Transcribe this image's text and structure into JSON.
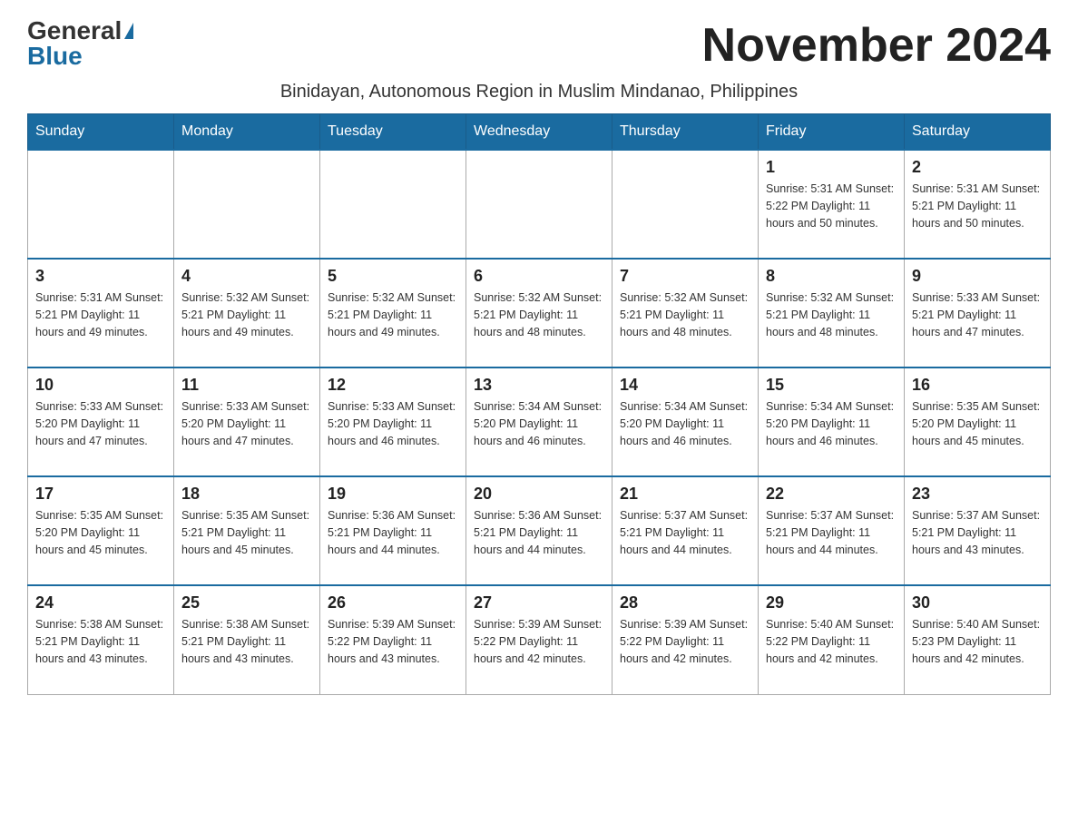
{
  "logo": {
    "general": "General",
    "blue": "Blue"
  },
  "title": "November 2024",
  "subtitle": "Binidayan, Autonomous Region in Muslim Mindanao, Philippines",
  "days_of_week": [
    "Sunday",
    "Monday",
    "Tuesday",
    "Wednesday",
    "Thursday",
    "Friday",
    "Saturday"
  ],
  "weeks": [
    [
      {
        "day": "",
        "info": ""
      },
      {
        "day": "",
        "info": ""
      },
      {
        "day": "",
        "info": ""
      },
      {
        "day": "",
        "info": ""
      },
      {
        "day": "",
        "info": ""
      },
      {
        "day": "1",
        "info": "Sunrise: 5:31 AM\nSunset: 5:22 PM\nDaylight: 11 hours and 50 minutes."
      },
      {
        "day": "2",
        "info": "Sunrise: 5:31 AM\nSunset: 5:21 PM\nDaylight: 11 hours and 50 minutes."
      }
    ],
    [
      {
        "day": "3",
        "info": "Sunrise: 5:31 AM\nSunset: 5:21 PM\nDaylight: 11 hours and 49 minutes."
      },
      {
        "day": "4",
        "info": "Sunrise: 5:32 AM\nSunset: 5:21 PM\nDaylight: 11 hours and 49 minutes."
      },
      {
        "day": "5",
        "info": "Sunrise: 5:32 AM\nSunset: 5:21 PM\nDaylight: 11 hours and 49 minutes."
      },
      {
        "day": "6",
        "info": "Sunrise: 5:32 AM\nSunset: 5:21 PM\nDaylight: 11 hours and 48 minutes."
      },
      {
        "day": "7",
        "info": "Sunrise: 5:32 AM\nSunset: 5:21 PM\nDaylight: 11 hours and 48 minutes."
      },
      {
        "day": "8",
        "info": "Sunrise: 5:32 AM\nSunset: 5:21 PM\nDaylight: 11 hours and 48 minutes."
      },
      {
        "day": "9",
        "info": "Sunrise: 5:33 AM\nSunset: 5:21 PM\nDaylight: 11 hours and 47 minutes."
      }
    ],
    [
      {
        "day": "10",
        "info": "Sunrise: 5:33 AM\nSunset: 5:20 PM\nDaylight: 11 hours and 47 minutes."
      },
      {
        "day": "11",
        "info": "Sunrise: 5:33 AM\nSunset: 5:20 PM\nDaylight: 11 hours and 47 minutes."
      },
      {
        "day": "12",
        "info": "Sunrise: 5:33 AM\nSunset: 5:20 PM\nDaylight: 11 hours and 46 minutes."
      },
      {
        "day": "13",
        "info": "Sunrise: 5:34 AM\nSunset: 5:20 PM\nDaylight: 11 hours and 46 minutes."
      },
      {
        "day": "14",
        "info": "Sunrise: 5:34 AM\nSunset: 5:20 PM\nDaylight: 11 hours and 46 minutes."
      },
      {
        "day": "15",
        "info": "Sunrise: 5:34 AM\nSunset: 5:20 PM\nDaylight: 11 hours and 46 minutes."
      },
      {
        "day": "16",
        "info": "Sunrise: 5:35 AM\nSunset: 5:20 PM\nDaylight: 11 hours and 45 minutes."
      }
    ],
    [
      {
        "day": "17",
        "info": "Sunrise: 5:35 AM\nSunset: 5:20 PM\nDaylight: 11 hours and 45 minutes."
      },
      {
        "day": "18",
        "info": "Sunrise: 5:35 AM\nSunset: 5:21 PM\nDaylight: 11 hours and 45 minutes."
      },
      {
        "day": "19",
        "info": "Sunrise: 5:36 AM\nSunset: 5:21 PM\nDaylight: 11 hours and 44 minutes."
      },
      {
        "day": "20",
        "info": "Sunrise: 5:36 AM\nSunset: 5:21 PM\nDaylight: 11 hours and 44 minutes."
      },
      {
        "day": "21",
        "info": "Sunrise: 5:37 AM\nSunset: 5:21 PM\nDaylight: 11 hours and 44 minutes."
      },
      {
        "day": "22",
        "info": "Sunrise: 5:37 AM\nSunset: 5:21 PM\nDaylight: 11 hours and 44 minutes."
      },
      {
        "day": "23",
        "info": "Sunrise: 5:37 AM\nSunset: 5:21 PM\nDaylight: 11 hours and 43 minutes."
      }
    ],
    [
      {
        "day": "24",
        "info": "Sunrise: 5:38 AM\nSunset: 5:21 PM\nDaylight: 11 hours and 43 minutes."
      },
      {
        "day": "25",
        "info": "Sunrise: 5:38 AM\nSunset: 5:21 PM\nDaylight: 11 hours and 43 minutes."
      },
      {
        "day": "26",
        "info": "Sunrise: 5:39 AM\nSunset: 5:22 PM\nDaylight: 11 hours and 43 minutes."
      },
      {
        "day": "27",
        "info": "Sunrise: 5:39 AM\nSunset: 5:22 PM\nDaylight: 11 hours and 42 minutes."
      },
      {
        "day": "28",
        "info": "Sunrise: 5:39 AM\nSunset: 5:22 PM\nDaylight: 11 hours and 42 minutes."
      },
      {
        "day": "29",
        "info": "Sunrise: 5:40 AM\nSunset: 5:22 PM\nDaylight: 11 hours and 42 minutes."
      },
      {
        "day": "30",
        "info": "Sunrise: 5:40 AM\nSunset: 5:23 PM\nDaylight: 11 hours and 42 minutes."
      }
    ]
  ]
}
